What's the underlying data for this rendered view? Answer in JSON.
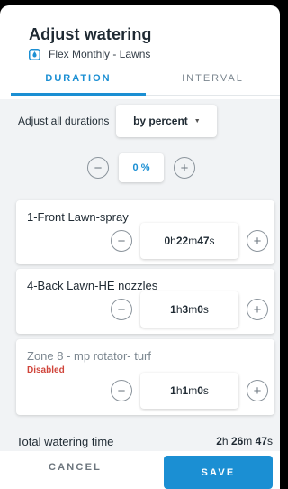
{
  "header": {
    "title": "Adjust watering",
    "schedule_icon": "water-drop-icon",
    "schedule_name": "Flex Monthly - Lawns"
  },
  "tabs": [
    {
      "label": "DURATION",
      "active": true
    },
    {
      "label": "INTERVAL",
      "active": false
    }
  ],
  "adjust_all": {
    "label": "Adjust all durations",
    "mode": "by percent",
    "percent_value": "0 %",
    "minus": "−",
    "plus": "+"
  },
  "zones": [
    {
      "name": "1-Front Lawn-spray",
      "status": "",
      "h": "0",
      "m": "22",
      "s": "47"
    },
    {
      "name": "4-Back Lawn-HE nozzles",
      "status": "",
      "h": "1",
      "m": "3",
      "s": "0"
    },
    {
      "name": "Zone 8 - mp rotator- turf",
      "status": "Disabled",
      "h": "1",
      "m": "1",
      "s": "0"
    }
  ],
  "units": {
    "h": "h ",
    "m": "m ",
    "s": "s"
  },
  "total": {
    "label": "Total watering time",
    "h": "2",
    "m": "26",
    "s": "47"
  },
  "footer": {
    "cancel": "CANCEL",
    "save": "SAVE"
  },
  "colors": {
    "accent": "#1b8fd3",
    "danger": "#d0453b",
    "panel": "#f1f3f5"
  }
}
